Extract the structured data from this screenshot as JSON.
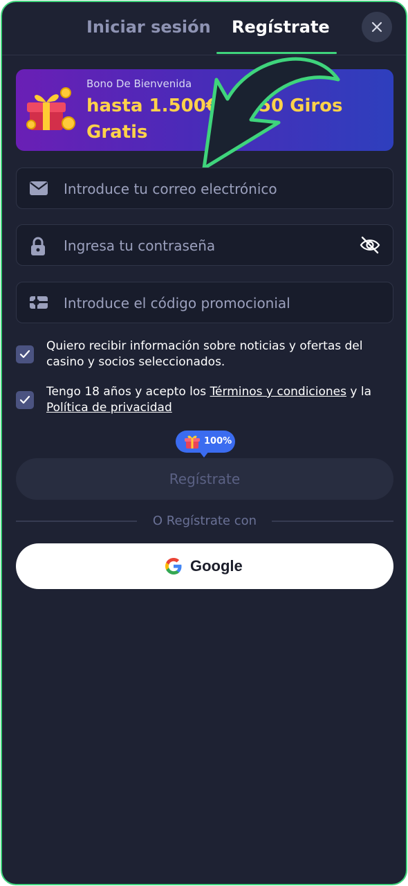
{
  "tabs": {
    "login": "Iniciar sesión",
    "register": "Regístrate"
  },
  "banner": {
    "subtitle": "Bono De Bienvenida",
    "title": "hasta 1.500€ + 150 Giros Gratis"
  },
  "form": {
    "email_placeholder": "Introduce tu correo electrónico",
    "password_placeholder": "Ingresa tu contraseña",
    "promo_placeholder": "Introduce el código promocionial"
  },
  "consents": {
    "news_text": "Quiero recibir información sobre noticias y ofertas del casino y socios seleccionados.",
    "age_prefix": "Tengo 18 años y acepto los ",
    "terms_link": "Términos y condiciones",
    "age_middle": " y la ",
    "privacy_link": "Política de privacidad",
    "news_checked": true,
    "age_checked": true
  },
  "bonus_badge": {
    "value": "100%"
  },
  "submit": {
    "label": "Regístrate"
  },
  "divider": {
    "text": "O Regístrate con"
  },
  "google": {
    "label": "Google"
  },
  "colors": {
    "background": "#1e2233",
    "accent": "#3fd47c",
    "banner_text": "#ffd24a",
    "badge": "#3b6cf0"
  },
  "icons": [
    "close-icon",
    "mail-icon",
    "lock-icon",
    "eye-off-icon",
    "gift-card-icon",
    "check-icon",
    "gift-icon",
    "google-icon",
    "arrow-annotation"
  ]
}
